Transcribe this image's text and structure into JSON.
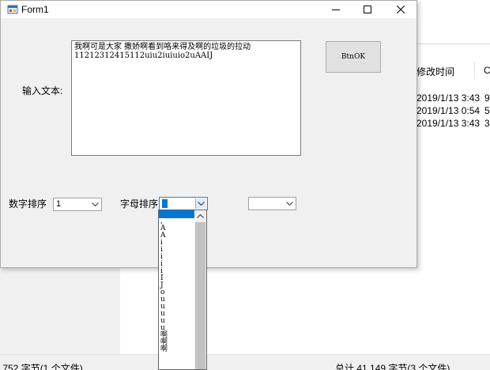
{
  "window": {
    "title": "Form1"
  },
  "form": {
    "input_label": "输入文本:",
    "textarea_value": "我啊可是大家 撒娇啊看到咯来得及啊的垃圾的拉动\n11212312415112uiu2iuiuio2uAAIJ",
    "button_label": "BtnOK",
    "number_sort_label": "数字排序",
    "number_sort_value": "1",
    "letter_sort_label": "字母排序",
    "dropdown_items": [
      ",",
      "A",
      "A",
      "i",
      "i",
      "i",
      "i",
      "i",
      "I",
      "J",
      "o",
      "u",
      "u",
      "u",
      "u",
      "u",
      "啊",
      "啊",
      "啊"
    ]
  },
  "background": {
    "col_modified": "修改时间",
    "col_c": "C",
    "rows": [
      {
        "time": "2019/1/13 3:43",
        "size": "9"
      },
      {
        "time": "2019/1/13 0:54",
        "size": "5"
      },
      {
        "time": "2019/1/13 3:43",
        "size": "3"
      }
    ],
    "status_left": ",752 字节(1 个文件)",
    "status_right": "总计 41,149 字节(3 个文件)"
  }
}
